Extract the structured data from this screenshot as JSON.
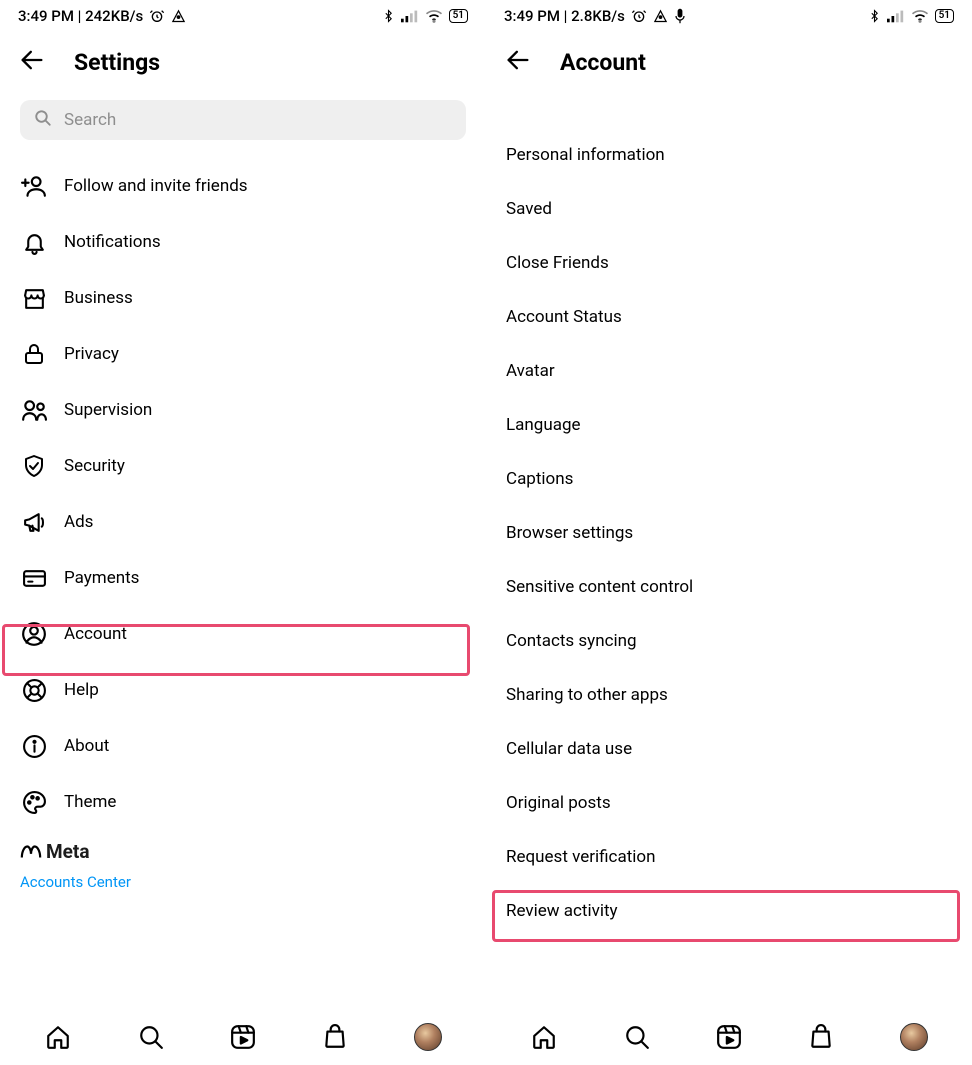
{
  "left": {
    "status": {
      "time_speed": "3:49 PM | 242KB/s",
      "battery": "51"
    },
    "header": {
      "title": "Settings"
    },
    "search": {
      "placeholder": "Search"
    },
    "items": [
      {
        "key": "follow",
        "label": "Follow and invite friends"
      },
      {
        "key": "notifications",
        "label": "Notifications"
      },
      {
        "key": "business",
        "label": "Business"
      },
      {
        "key": "privacy",
        "label": "Privacy"
      },
      {
        "key": "supervision",
        "label": "Supervision"
      },
      {
        "key": "security",
        "label": "Security"
      },
      {
        "key": "ads",
        "label": "Ads"
      },
      {
        "key": "payments",
        "label": "Payments"
      },
      {
        "key": "account",
        "label": "Account",
        "highlighted": true
      },
      {
        "key": "help",
        "label": "Help"
      },
      {
        "key": "about",
        "label": "About"
      },
      {
        "key": "theme",
        "label": "Theme"
      }
    ],
    "meta": {
      "brand": "Meta",
      "link": "Accounts Center"
    }
  },
  "right": {
    "status": {
      "time_speed": "3:49 PM | 2.8KB/s",
      "battery": "51"
    },
    "header": {
      "title": "Account"
    },
    "items": [
      {
        "label": "Personal information"
      },
      {
        "label": "Saved"
      },
      {
        "label": "Close Friends"
      },
      {
        "label": "Account Status"
      },
      {
        "label": "Avatar"
      },
      {
        "label": "Language"
      },
      {
        "label": "Captions"
      },
      {
        "label": "Browser settings"
      },
      {
        "label": "Sensitive content control"
      },
      {
        "label": "Contacts syncing"
      },
      {
        "label": "Sharing to other apps"
      },
      {
        "label": "Cellular data use"
      },
      {
        "label": "Original posts"
      },
      {
        "label": "Request verification",
        "highlighted": true
      },
      {
        "label": "Review activity"
      }
    ]
  },
  "highlight_color": "#e84a6f"
}
